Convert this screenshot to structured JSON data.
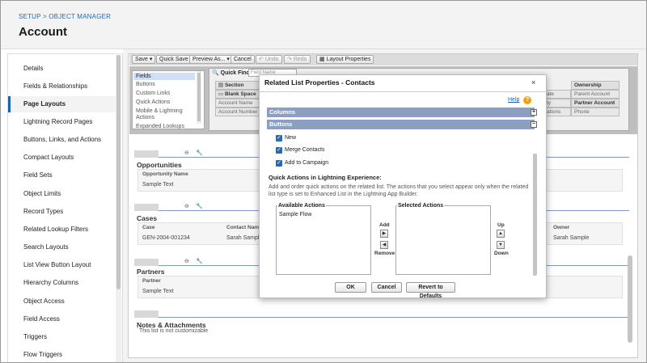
{
  "header": {
    "breadcrumb": "SETUP > OBJECT MANAGER",
    "title": "Account"
  },
  "sidebar": {
    "items": [
      {
        "label": "Details"
      },
      {
        "label": "Fields & Relationships"
      },
      {
        "label": "Page Layouts",
        "active": true
      },
      {
        "label": "Lightning Record Pages"
      },
      {
        "label": "Buttons, Links, and Actions"
      },
      {
        "label": "Compact Layouts"
      },
      {
        "label": "Field Sets"
      },
      {
        "label": "Object Limits"
      },
      {
        "label": "Record Types"
      },
      {
        "label": "Related Lookup Filters"
      },
      {
        "label": "Search Layouts"
      },
      {
        "label": "List View Button Layout"
      },
      {
        "label": "Hierarchy Columns"
      },
      {
        "label": "Object Access"
      },
      {
        "label": "Field Access"
      },
      {
        "label": "Triggers"
      },
      {
        "label": "Flow Triggers"
      }
    ]
  },
  "toolbar": {
    "save": "Save",
    "quick_save": "Quick Save",
    "preview_as": "Preview As...",
    "cancel": "Cancel",
    "undo": "Undo",
    "redo": "Redo",
    "layout_properties": "Layout Properties"
  },
  "palette": {
    "categories": [
      "Fields",
      "Buttons",
      "Custom Links",
      "Quick Actions",
      "Mobile & Lightning",
      "Actions",
      "Expanded Lookups"
    ],
    "quick_find_label": "Quick Find",
    "quick_find_placeholder": "Field Name",
    "chips": {
      "section": "Section",
      "blank_space": "Blank Space",
      "account_name": "Account Name",
      "account_number": "Account Number",
      "ownership": "Ownership",
      "parent_account": "Parent Account",
      "partner_account": "Partner Account",
      "phone": "Phone",
      "cut_1": "ate",
      "cut_2": "ty",
      "cut_3": "ations"
    }
  },
  "layout": {
    "opportunities": {
      "title": "Opportunities",
      "col": "Opportunity Name",
      "value": "Sample Text"
    },
    "cases": {
      "title": "Cases",
      "cols": [
        "Case",
        "Contact Name"
      ],
      "values": [
        "GEN-2004-001234",
        "Sarah Sample"
      ],
      "owner_col": "Owner",
      "owner_value": "Sarah Sample"
    },
    "partners": {
      "title": "Partners",
      "col": "Partner",
      "value": "Sample Text"
    },
    "notes": {
      "title": "Notes & Attachments",
      "note": "This list is not customizable"
    }
  },
  "modal": {
    "title": "Related List Properties - Contacts",
    "close": "×",
    "help": "Help",
    "help_icon": "?",
    "sections": {
      "columns": "Columns",
      "buttons": "Buttons"
    },
    "checkboxes": [
      {
        "label": "New",
        "checked": true
      },
      {
        "label": "Merge Contacts",
        "checked": true
      },
      {
        "label": "Add to Campaign",
        "checked": true
      }
    ],
    "qa_title": "Quick Actions in Lightning Experience:",
    "qa_desc": "Add and order quick actions on the related list. The actions that you select appear only when the related list type is set to Enhanced List in the Lightning App Builder.",
    "available_title": "Available Actions",
    "available_items": [
      "Sample Flow"
    ],
    "selected_title": "Selected Actions",
    "add_label": "Add",
    "remove_label": "Remove",
    "up_label": "Up",
    "down_label": "Down",
    "ok": "OK",
    "cancel": "Cancel",
    "revert": "Revert to Defaults"
  }
}
